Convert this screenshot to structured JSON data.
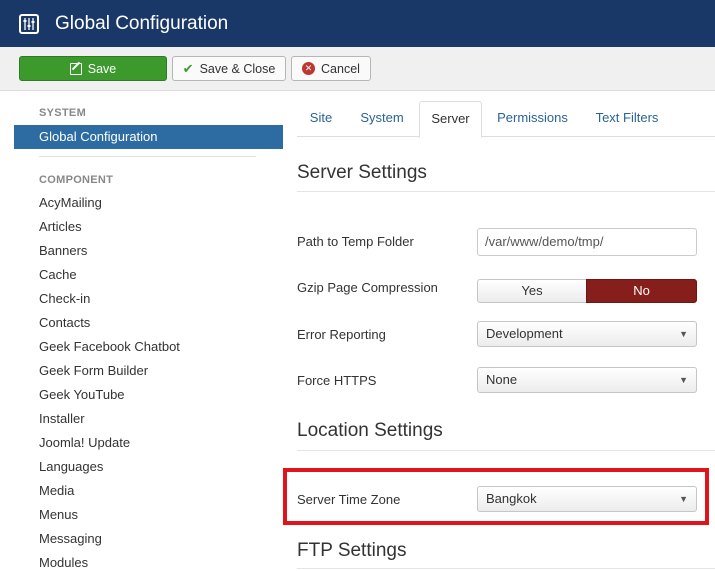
{
  "header": {
    "title": "Global Configuration",
    "bg_color": "#1a3867",
    "icon": "sliders-icon"
  },
  "toolbar": {
    "save_label": "Save",
    "save_close_label": "Save & Close",
    "cancel_label": "Cancel",
    "save_color": "#3c9a2d"
  },
  "sidebar": {
    "system_heading": "SYSTEM",
    "active_item": "Global Configuration",
    "component_heading": "COMPONENT",
    "items": [
      "AcyMailing",
      "Articles",
      "Banners",
      "Cache",
      "Check-in",
      "Contacts",
      "Geek Facebook Chatbot",
      "Geek Form Builder",
      "Geek YouTube",
      "Installer",
      "Joomla! Update",
      "Languages",
      "Media",
      "Menus",
      "Messaging",
      "Modules"
    ],
    "active_color": "#2d6ca2"
  },
  "tabs": {
    "items": [
      "Site",
      "System",
      "Server",
      "Permissions",
      "Text Filters"
    ],
    "active": "Server"
  },
  "server_settings": {
    "title": "Server Settings",
    "temp_folder_label": "Path to Temp Folder",
    "temp_folder_value": "/var/www/demo/tmp/",
    "gzip_label": "Gzip Page Compression",
    "gzip_yes": "Yes",
    "gzip_no": "No",
    "gzip_selected": "No",
    "error_reporting_label": "Error Reporting",
    "error_reporting_value": "Development",
    "force_https_label": "Force HTTPS",
    "force_https_value": "None"
  },
  "location_settings": {
    "title": "Location Settings",
    "timezone_label": "Server Time Zone",
    "timezone_value": "Bangkok"
  },
  "ftp_settings": {
    "title": "FTP Settings"
  },
  "highlight_color": "#e0151b",
  "toggle_no_color": "#861f1b"
}
